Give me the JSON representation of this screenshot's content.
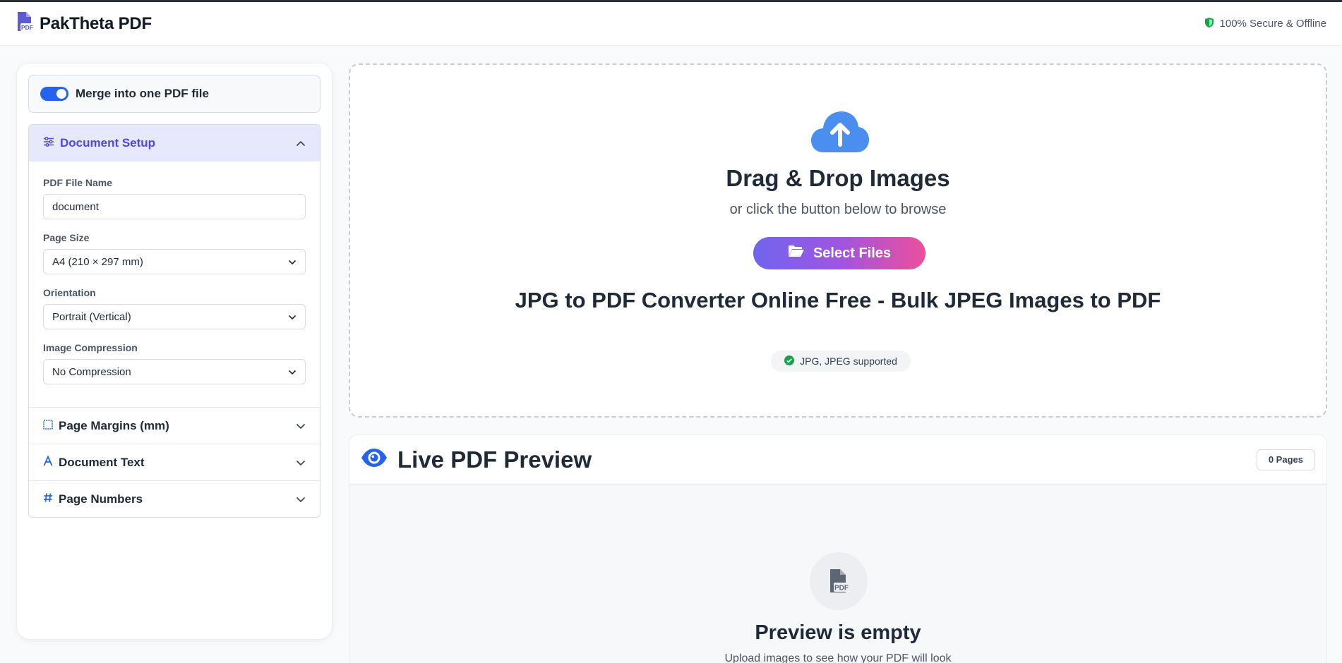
{
  "app": {
    "name": "PakTheta PDF",
    "secure_text": "100% Secure & Offline"
  },
  "sidebar": {
    "merge_label": "Merge into one PDF file",
    "merge_enabled": true,
    "sections": {
      "document_setup": "Document Setup",
      "page_margins": "Page Margins (mm)",
      "document_text": "Document Text",
      "page_numbers": "Page Numbers"
    },
    "fields": {
      "file_name_label": "PDF File Name",
      "file_name_value": "document",
      "page_size_label": "Page Size",
      "page_size_value": "A4 (210 × 297 mm)",
      "orientation_label": "Orientation",
      "orientation_value": "Portrait (Vertical)",
      "compression_label": "Image Compression",
      "compression_value": "No Compression"
    }
  },
  "dropzone": {
    "title": "Drag & Drop Images",
    "subtitle": "or click the button below to browse",
    "button_label": "Select Files",
    "heading": "JPG to PDF Converter Online Free - Bulk JPEG Images to PDF",
    "supported": "JPG, JPEG supported"
  },
  "preview": {
    "title": "Live PDF Preview",
    "pages_badge": "0 Pages",
    "empty_title": "Preview is empty",
    "empty_subtitle": "Upload images to see how your PDF will look"
  },
  "colors": {
    "accent": "#2563eb",
    "brand": "#5b5bd6",
    "section_active_bg": "#e8e8fc",
    "section_active_text": "#4f46e5",
    "success": "#16a34a",
    "gradient_start": "#7065ee",
    "gradient_end": "#ec4f9c"
  },
  "icons": {
    "logo": "pdf-file-icon",
    "secure": "shield-icon",
    "document_setup": "sliders-icon",
    "page_margins": "margin-square-icon",
    "document_text": "font-icon",
    "page_numbers": "hash-icon",
    "upload": "cloud-upload-icon",
    "select_files": "folder-open-icon",
    "supported": "check-circle-icon",
    "preview": "eye-icon",
    "empty": "pdf-file-icon"
  }
}
